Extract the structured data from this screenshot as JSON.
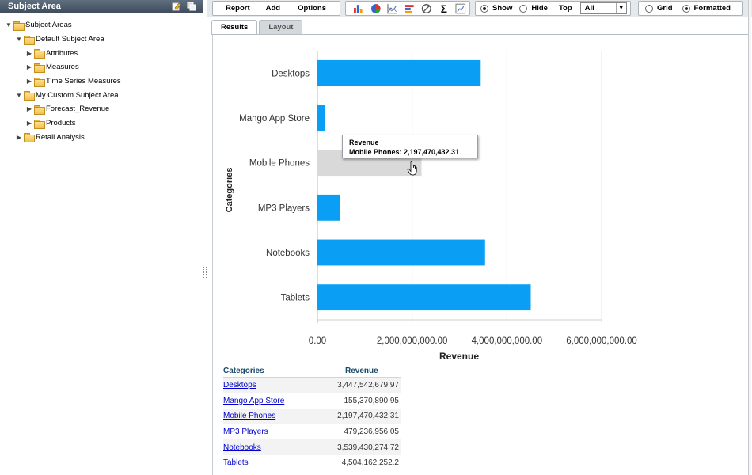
{
  "left_panel": {
    "title": "Subject Area",
    "tree": [
      {
        "label": "Subject Areas",
        "depth": 0,
        "state": "expanded"
      },
      {
        "label": "Default Subject Area",
        "depth": 1,
        "state": "expanded"
      },
      {
        "label": "Attributes",
        "depth": 2,
        "state": "collapsed"
      },
      {
        "label": "Measures",
        "depth": 2,
        "state": "collapsed"
      },
      {
        "label": "Time Series Measures",
        "depth": 2,
        "state": "collapsed"
      },
      {
        "label": "My Custom Subject Area",
        "depth": 1,
        "state": "expanded"
      },
      {
        "label": "Forecast_Revenue",
        "depth": 2,
        "state": "collapsed"
      },
      {
        "label": "Products",
        "depth": 2,
        "state": "collapsed"
      },
      {
        "label": "Retail Analysis",
        "depth": 1,
        "state": "collapsed"
      }
    ]
  },
  "toolbar": {
    "report_label": "Report",
    "add_label": "Add",
    "options_label": "Options",
    "chart_icons": [
      "bar-chart-icon",
      "pie-chart-icon",
      "line-chart-icon",
      "horizontal-bar-icon",
      "no-chart-icon",
      "sigma-icon",
      "edit-chart-icon"
    ],
    "show_label": "Show",
    "hide_label": "Hide",
    "top_label": "Top",
    "top_value": "All",
    "grid_label": "Grid",
    "formatted_label": "Formatted",
    "show_selected": true,
    "formatted_selected": true
  },
  "tabs": [
    {
      "label": "Results",
      "active": true
    },
    {
      "label": "Layout",
      "active": false
    }
  ],
  "chart_data": {
    "type": "bar",
    "orientation": "horizontal",
    "categories": [
      "Desktops",
      "Mango App Store",
      "Mobile Phones",
      "MP3 Players",
      "Notebooks",
      "Tablets"
    ],
    "values": [
      3447542679.97,
      155370890.95,
      2197470432.31,
      479236956.05,
      3539430274.72,
      4504162252.2
    ],
    "highlighted": "Mobile Phones",
    "xlabel": "Revenue",
    "ylabel": "Categories",
    "xlim": [
      0,
      6000000000
    ],
    "x_ticks": [
      "0.00",
      "2,000,000,000.00",
      "4,000,000,000.00",
      "6,000,000,000.00"
    ],
    "colors": {
      "bar": "#0a9ef5",
      "highlight": "#d9d9d9"
    }
  },
  "tooltip": {
    "title": "Revenue",
    "body": "Mobile Phones: 2,197,470,432.31"
  },
  "table": {
    "headers": [
      "Categories",
      "Revenue"
    ],
    "rows": [
      [
        "Desktops",
        "3,447,542,679.97"
      ],
      [
        "Mango App Store",
        "155,370,890.95"
      ],
      [
        "Mobile Phones",
        "2,197,470,432.31"
      ],
      [
        "MP3 Players",
        "479,236,956.05"
      ],
      [
        "Notebooks",
        "3,539,430,274.72"
      ],
      [
        "Tablets",
        "4,504,162,252.2"
      ]
    ]
  }
}
